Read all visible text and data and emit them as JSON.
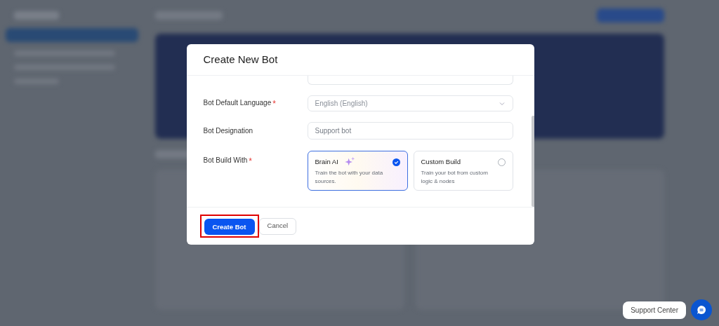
{
  "modal": {
    "title": "Create New Bot",
    "fields": [
      {
        "kind": "select",
        "label": "Bot Default Language",
        "required_mark": "*",
        "value": "English (English)"
      },
      {
        "kind": "text",
        "label": "Bot Designation",
        "placeholder": "Support bot"
      }
    ],
    "build": {
      "label": "Bot Build With",
      "required_mark": "*",
      "options": [
        {
          "title": "Brain AI",
          "description": "Train the bot with your data sources.",
          "selected": true,
          "sparkle": true
        },
        {
          "title": "Custom Build",
          "description": "Train your bot from custom logic & nodes",
          "selected": false,
          "sparkle": false
        }
      ]
    },
    "buttons": [
      {
        "label": "Create Bot",
        "kind": "primary",
        "highlighted": true
      },
      {
        "label": "Cancel",
        "kind": "secondary",
        "highlighted": false
      }
    ]
  },
  "support": {
    "label": "Support Center"
  }
}
